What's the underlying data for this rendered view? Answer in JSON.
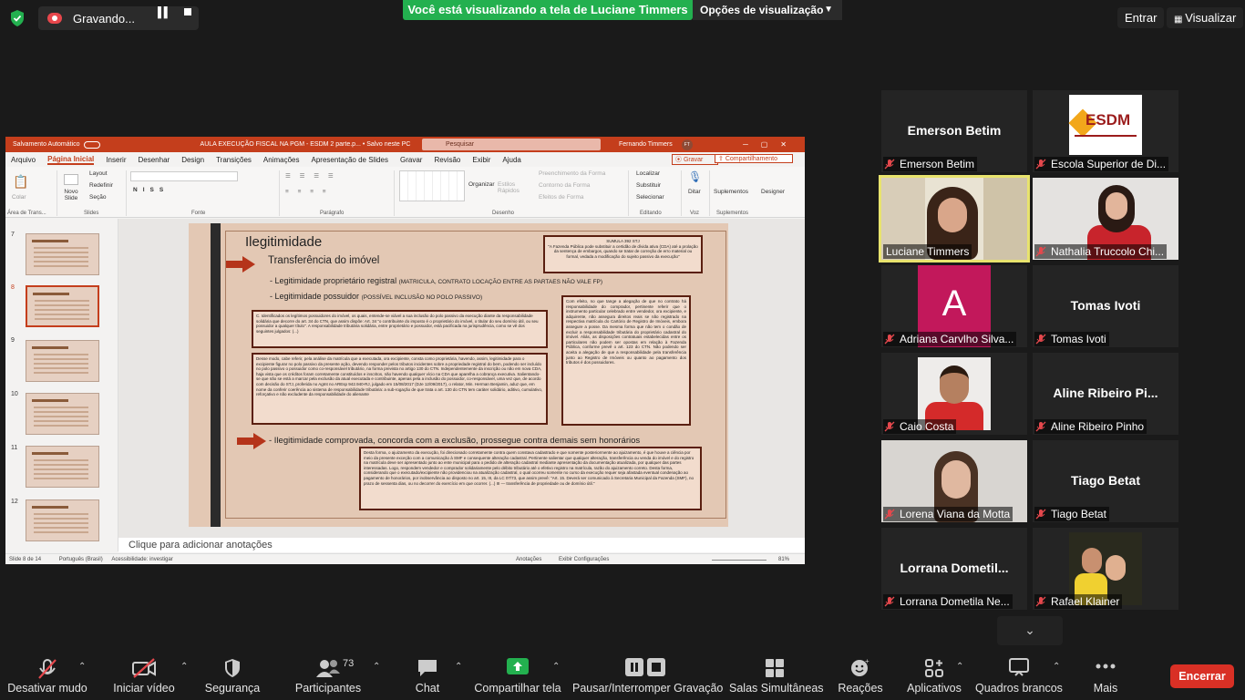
{
  "recording": {
    "status": "Gravando..."
  },
  "banner": {
    "share_text": "Você está visualizando a tela de Luciane Timmers",
    "view_options": "Opções de visualização"
  },
  "top_right": {
    "enter": "Entrar",
    "view": "Visualizar"
  },
  "ppt": {
    "autosave": "Salvamento Automático",
    "file_title": "AULA EXECUÇÃO FISCAL NA PGM - ESDM 2 parte.p... • Salvo neste PC",
    "search_placeholder": "Pesquisar",
    "user": "Fernando Timmers",
    "user_initials": "FT",
    "menu": [
      "Arquivo",
      "Página Inicial",
      "Inserir",
      "Desenhar",
      "Design",
      "Transições",
      "Animações",
      "Apresentação de Slides",
      "Gravar",
      "Revisão",
      "Exibir",
      "Ajuda"
    ],
    "gravar_btn": "Gravar",
    "share_btn": "Compartilhamento",
    "ribbon": {
      "groups": [
        "Área de Trans...",
        "Slides",
        "Fonte",
        "Parágrafo",
        "Desenho",
        "Editando",
        "Voz",
        "Suplementos"
      ],
      "colar": "Colar",
      "novo_slide": "Novo Slide",
      "layout": "Layout",
      "redefinir": "Redefinir",
      "secao": "Seção",
      "organizar": "Organizar",
      "estilos": "Estilos Rápidos",
      "preenchimento": "Preenchimento da Forma",
      "contorno": "Contorno da Forma",
      "efeitos": "Efeitos de Forma",
      "localizar": "Localizar",
      "substituir": "Substituir",
      "selecionar": "Selecionar",
      "ditar": "Ditar",
      "suplementos": "Suplementos",
      "designer": "Designer"
    },
    "thumb_numbers": [
      "7",
      "8",
      "9",
      "10",
      "11",
      "12"
    ],
    "slide": {
      "title": "Ilegitimidade",
      "subtitle": "Transferência do imóvel",
      "bullet1": "- Legitimidade proprietário registral",
      "bullet1_note": "(MATRICULA, CONTRATO LOCAÇÃO ENTRE AS PARTAES NÃO VALE FP)",
      "bullet2": "- Legitimidade possuidor",
      "bullet2_note": "(POSSÍVEL INCLUSÃO NO POLO PASSIVO)",
      "sumula_title": "SUMULA 392 STJ",
      "sumula_text": "\"A Fazenda Pública pode substituir a certidão de dívida ativa (CDA) até a prolação da sentença de embargos, quando se tratar de correção de erro material ou formal, vedada a modificação do sujeito passivo da execução\"",
      "box1": "C. Identificados os legítimos possuidores do imóvel, os quais, entende-se viável a sua inclusão do polo passivo da execução diante da responsabilidade solidária que decorre do art. 34 do CTN, que assim dispõe: Art. 34 \"o contribuinte do imposto é o proprietário do imóvel, o titular do seu domínio útil, ou seu possuidor a qualquer título\". A responsabilidade tributária solidária, entre proprietário e possuidor, está pacificada na jurisprudência, como se vê dos seguintes julgados: (...)",
      "box2": "Desse modo, cabe referir, pela análise da matrícula que a executada, ora excipiente, consta como proprietária, havendo, assim, legitimidade para o excipiente figurar no polo passivo da presente ação, devendo responder pelos tributos incidentes sobre a propriedade registral do bem, podendo ser incluído no polo passivo o possuidor como co-responsável tributário, na forma prevista no artigo 130 do CTN. Independentemente da inscrição ou não em nova CDA, haja vista que os créditos foram corretamente constituídos e inscritos, não havendo qualquer vício na CDA que aparelha a cobrança executiva. Salientando-se que não se está a marcar pela exclusão da atual executada e contribuinte, apenas pela a inclusão do possuidor, co-responsável, uma vez que, de acordo com decisão do STJ, proferida no AgInt no AREsp 942.940-RJ, julgado em 15/08/2017 (DJe 12/09/2017), o relator, Min. Herman Benjamin, aduz que, em nome da conferir coerência ao sistema de responsabilidade tributária: a sub-rogação de que trata o art. 130 do CTN tem caráter solidário, aditivo, cumulativo, reforçativo e não excludente da responsabilidade do alienante",
      "box3": "Com efeito, no que tange a alegação de que no contrato há responsabilidade do comprador, pertinente referir que o instrumento particular celebrado entre vendedor, ora excipiente, e adquirente, não assegura direitos reais se não registrado na respectiva matrícula do Cartório de Registro de Imóveis, embora assegure a posse. Da mesma forma que não tem o condão de excluir a responsabilidade tributária do proprietário cadastral do imóvel. Aliás, as disposições contratuais estabelecidas entre os particulares não podem ser opostas em relação à Fazenda Pública, conforme prevê o art. 123 do CTN. Não podendo ser aceita a alegação de que a responsabilidade pela transferência junto ao Registro de Imóveis ou quanto ao pagamento dos tributos é dos possuidores.",
      "bullet3": "- Ilegitimidade comprovada, concorda com a exclusão, prossegue contra demais sem honorários",
      "box4": "Desta forma, o ajuizamento da execução, foi direcionado corretamente contra quem constava cadastrado e que somente posteriormente ao ajuizamento, é que houve a ciência por meio da presente exceção com a comunicação à SMF e consequente alteração cadastral. Pertinente salientar que qualquer alteração, transferência ou venda do imóvel e do registro na matrícula deve ser apresentado junto ao ente municipal para o pedido de alteração cadastral mediante apresentação da documentação atualizada, por qualquer das partes interessadas. Logo, respondem vendedor e comprador solidariamente pelo débito tributário até o efetivo registro na matrícula, razão do ajuizamento correto. Desta forma, considerando que o executado/excipiente não providenciou na atualização cadastral, o qual ocorreu somente no curso da execução requer seja afastada eventual condenação ao pagamento de honorários, por inobservância ao disposto no art. 15, III, da LC 07/73, que assim prevê: \"Art. 15. Deverá ser comunicado à Secretaria Municipal da Fazenda (SMF), no prazo de sessenta dias, ou no decorrer do exercício em que ocorrer. (...) III — transferência de propriedade ou de domínio útil.\""
    },
    "notes_placeholder": "Clique para adicionar anotações",
    "status": {
      "slide": "Slide 8 de 14",
      "language": "Português (Brasil)",
      "accessibility": "Acessibilidade: investigar",
      "notes": "Anotações",
      "display": "Exibir Configurações",
      "zoom": "81%"
    }
  },
  "participants": [
    {
      "name": "Emerson Betim",
      "center": "Emerson Betim",
      "muted": true
    },
    {
      "name": "Escola Superior de Di...",
      "muted": true,
      "logo": "ESDM"
    },
    {
      "name": "Luciane Timmers",
      "muted": false,
      "active": true
    },
    {
      "name": "Nathalia Truccolo Chi...",
      "muted": true
    },
    {
      "name": "Adriana Carvlho Silva...",
      "muted": true,
      "avatar": "A"
    },
    {
      "name": "Tomas Ivoti",
      "center": "Tomas Ivoti",
      "muted": true
    },
    {
      "name": "Caio Costa",
      "muted": true
    },
    {
      "name": "Aline Ribeiro Pinho",
      "center": "Aline  Ribeiro  Pi...",
      "muted": true
    },
    {
      "name": "Lorena Viana da Motta",
      "muted": true
    },
    {
      "name": "Tiago Betat",
      "center": "Tiago Betat",
      "muted": true
    },
    {
      "name": "Lorrana Dometila Ne...",
      "center": "Lorrana  Dometil...",
      "muted": true
    },
    {
      "name": "Rafael Klainer",
      "muted": true
    }
  ],
  "toolbar": {
    "mute": "Desativar mudo",
    "video": "Iniciar vídeo",
    "security": "Segurança",
    "participants": "Participantes",
    "participants_count": "73",
    "chat": "Chat",
    "share": "Compartilhar tela",
    "record": "Pausar/Interromper Gravação",
    "breakout": "Salas Simultâneas",
    "reactions": "Reações",
    "apps": "Aplicativos",
    "whiteboards": "Quadros brancos",
    "more": "Mais",
    "end": "Encerrar"
  },
  "colors": {
    "share_green": "#23b04f",
    "end_red": "#d93025",
    "ppt_accent": "#c43e1c",
    "active_speaker": "#e8e36d",
    "avatar_pink": "#c2185b"
  }
}
